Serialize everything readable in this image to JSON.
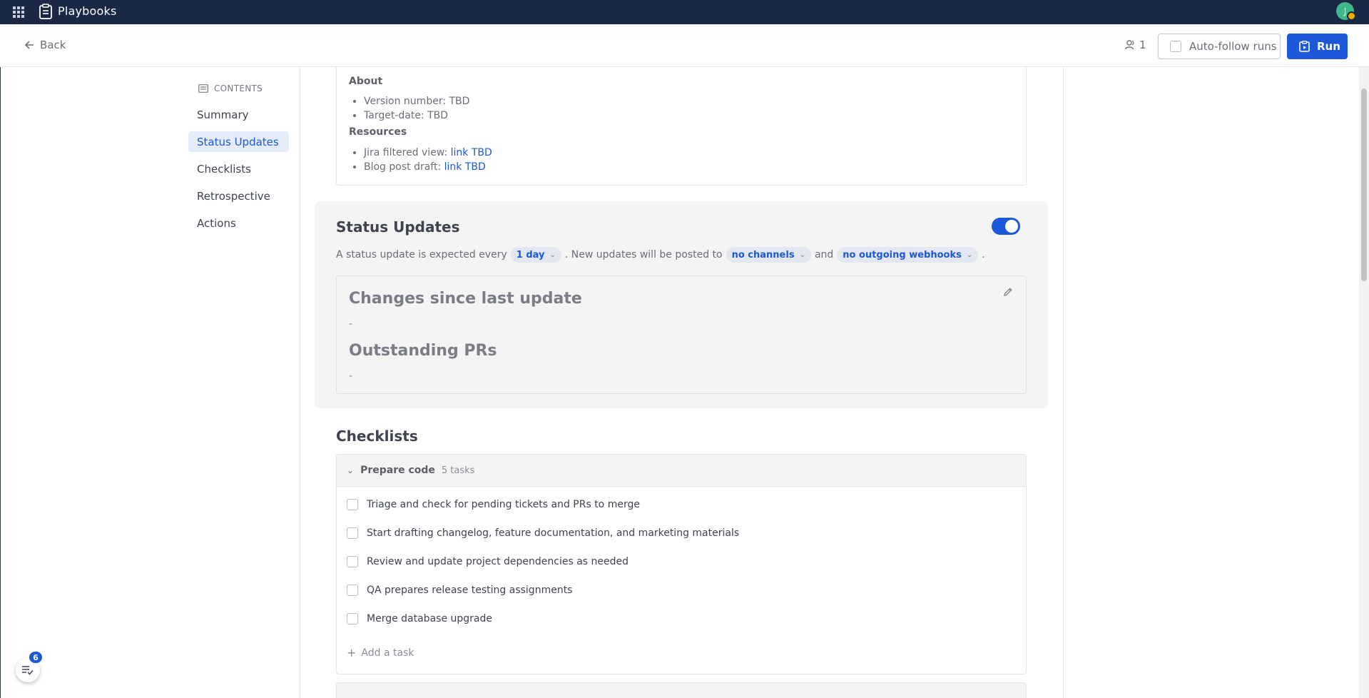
{
  "topbar": {
    "app_title": "Playbooks",
    "avatar_initial": "J"
  },
  "subheader": {
    "back_label": "Back",
    "followers_count": "1",
    "auto_follow_label": "Auto-follow runs",
    "run_label": "Run"
  },
  "toc": {
    "heading": "CONTENTS",
    "items": [
      {
        "label": "Summary",
        "active": false
      },
      {
        "label": "Status Updates",
        "active": true
      },
      {
        "label": "Checklists",
        "active": false
      },
      {
        "label": "Retrospective",
        "active": false
      },
      {
        "label": "Actions",
        "active": false
      }
    ]
  },
  "about": {
    "about_heading": "About",
    "about_items": [
      "Version number: TBD",
      "Target-date: TBD"
    ],
    "resources_heading": "Resources",
    "resources": [
      {
        "label": "Jira filtered view: ",
        "link": "link TBD"
      },
      {
        "label": "Blog post draft: ",
        "link": "link TBD"
      }
    ]
  },
  "status_updates": {
    "title": "Status Updates",
    "enabled": true,
    "sentence_prefix": "A status update is expected every",
    "interval": "1 day",
    "sentence_middle": ". New updates will be posted to",
    "channels": "no channels",
    "sentence_and": "and",
    "webhooks": "no outgoing webhooks",
    "sentence_end": ".",
    "template": {
      "heading_1": "Changes since last update",
      "text_1": "-",
      "heading_2": "Outstanding PRs",
      "text_2": "-"
    }
  },
  "checklists": {
    "title": "Checklists",
    "groups": [
      {
        "name": "Prepare code",
        "count_label": "5 tasks",
        "tasks": [
          "Triage and check for pending tickets and PRs to merge",
          "Start drafting changelog, feature documentation, and marketing materials",
          "Review and update project dependencies as needed",
          "QA prepares release testing assignments",
          "Merge database upgrade"
        ],
        "add_task_label": "Add a task"
      }
    ]
  },
  "fab": {
    "badge_count": "6"
  },
  "colors": {
    "topbar": "#1b2845",
    "accent": "#1c58d9",
    "panel": "#f4f4f5"
  }
}
